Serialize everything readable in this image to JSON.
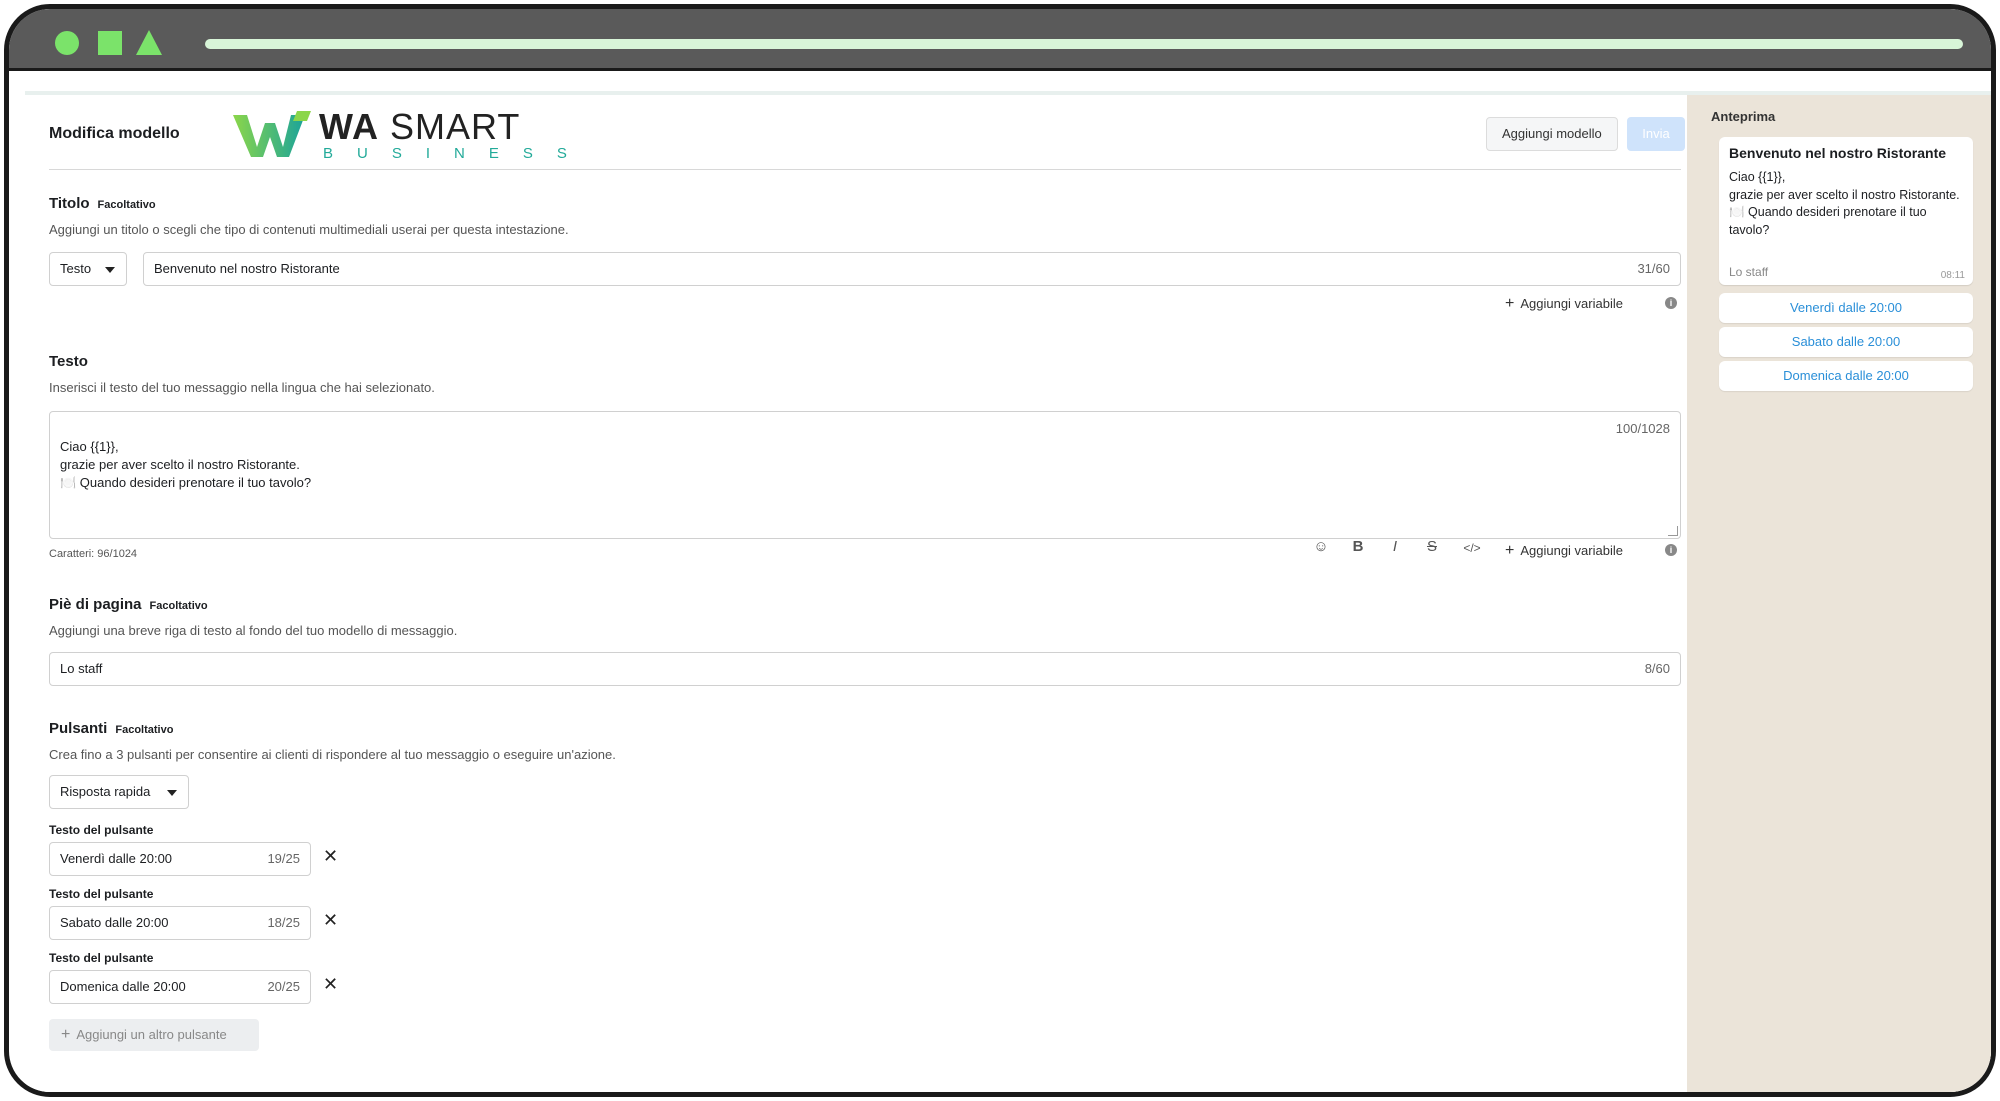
{
  "header": {
    "title": "Modifica modello",
    "logo_main_bold": "WA",
    "logo_main_light": " SMART",
    "logo_sub": "BUSINESS",
    "add_model_button": "Aggiungi modello",
    "send_button": "Invia"
  },
  "title_section": {
    "heading": "Titolo",
    "tag": "Facoltativo",
    "hint": "Aggiungi un titolo o scegli che tipo di contenuti multimediali userai per questa intestazione.",
    "type_select": "Testo",
    "value": "Benvenuto nel nostro Ristorante",
    "counter": "31/60",
    "add_variable": "Aggiungi variabile"
  },
  "body_section": {
    "heading": "Testo",
    "hint": "Inserisci il testo del tuo messaggio nella lingua che hai selezionato.",
    "text": "Ciao {{1}},\ngrazie per aver scelto il nostro Ristorante.\n🍽️ Quando desideri prenotare il tuo tavolo?",
    "counter": "100/1028",
    "char_count": "Caratteri: 96/1024",
    "add_variable": "Aggiungi variabile",
    "toolbar": {
      "emoji": "☺",
      "bold": "B",
      "italic": "I",
      "strike": "S",
      "code": "</>"
    }
  },
  "footer_section": {
    "heading": "Piè di pagina",
    "tag": "Facoltativo",
    "hint": "Aggiungi una breve riga di testo al fondo del tuo modello di messaggio.",
    "value": "Lo staff",
    "counter": "8/60"
  },
  "buttons_section": {
    "heading": "Pulsanti",
    "tag": "Facoltativo",
    "hint": "Crea fino a 3 pulsanti per consentire ai clienti di rispondere al tuo messaggio o eseguire un'azione.",
    "type_select": "Risposta rapida",
    "buttons": [
      {
        "label": "Testo del pulsante",
        "value": "Venerdì dalle 20:00",
        "counter": "19/25"
      },
      {
        "label": "Testo del pulsante",
        "value": "Sabato dalle 20:00",
        "counter": "18/25"
      },
      {
        "label": "Testo del pulsante",
        "value": "Domenica dalle 20:00",
        "counter": "20/25"
      }
    ],
    "add_more": "Aggiungi un altro pulsante"
  },
  "preview": {
    "heading": "Anteprima",
    "title": "Benvenuto nel nostro Ristorante",
    "body": "Ciao {{1}},\ngrazie per aver scelto il nostro Ristorante.\n🍽️ Quando desideri prenotare il tuo tavolo?",
    "footer": "Lo staff",
    "time": "08:11",
    "replies": [
      "Venerdì dalle 20:00",
      "Sabato dalle 20:00",
      "Domenica dalle 20:00"
    ]
  },
  "colors": {
    "accent_green": "#7be36a",
    "link_blue": "#2a8fd8",
    "preview_bg": "#ebe4d9"
  }
}
